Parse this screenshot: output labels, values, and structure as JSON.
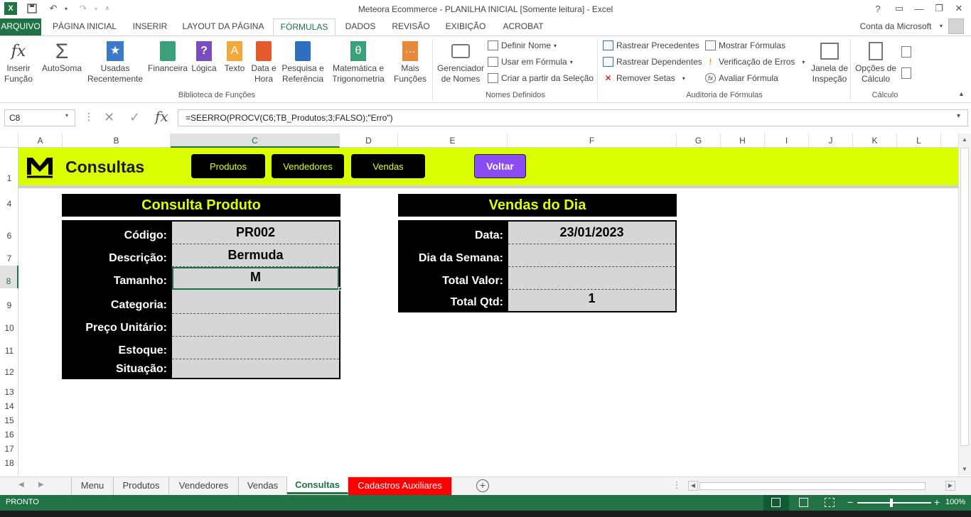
{
  "window": {
    "title": "Meteora Ecommerce - PLANILHA INICIAL  [Somente leitura] - Excel",
    "help": "?",
    "account": "Conta da Microsoft"
  },
  "tabs": [
    "ARQUIVO",
    "PÁGINA INICIAL",
    "INSERIR",
    "LAYOUT DA PÁGINA",
    "FÓRMULAS",
    "DADOS",
    "REVISÃO",
    "EXIBIÇÃO",
    "ACROBAT"
  ],
  "ribbon": {
    "insert_function": "Inserir Função",
    "autosum": "AutoSoma",
    "recent": "Usadas Recentemente",
    "financial": "Financeira",
    "logical": "Lógica",
    "text": "Texto",
    "datetime": "Data e Hora",
    "lookup": "Pesquisa e Referência",
    "math": "Matemática e Trigonometria",
    "more": "Mais Funções",
    "group_library": "Biblioteca de Funções",
    "name_manager": "Gerenciador de Nomes",
    "define_name": "Definir Nome",
    "use_in_formula": "Usar em Fórmula",
    "create_from_selection": "Criar a partir da Seleção",
    "group_names": "Nomes Definidos",
    "trace_precedents": "Rastrear Precedentes",
    "trace_dependents": "Rastrear Dependentes",
    "remove_arrows": "Remover Setas",
    "show_formulas": "Mostrar Fórmulas",
    "error_checking": "Verificação de Erros",
    "evaluate_formula": "Avaliar Fórmula",
    "watch_window": "Janela de Inspeção",
    "group_auditing": "Auditoria de Fórmulas",
    "calc_options": "Opções de Cálculo",
    "group_calc": "Cálculo"
  },
  "formula_bar": {
    "name_box": "C8",
    "formula": "=SEERRO(PROCV(C6;TB_Produtos;3;FALSO);\"Erro\")"
  },
  "columns": [
    "A",
    "B",
    "C",
    "D",
    "E",
    "F",
    "G",
    "H",
    "I",
    "J",
    "K",
    "L"
  ],
  "rows": [
    "1",
    "4",
    "6",
    "7",
    "8",
    "9",
    "10",
    "11",
    "12",
    "13",
    "14",
    "15",
    "16",
    "17",
    "18"
  ],
  "banner": {
    "logo": "M",
    "title": "Consultas",
    "buttons": [
      "Produtos",
      "Vendedores",
      "Vendas"
    ],
    "back": "Voltar"
  },
  "product_panel": {
    "header": "Consulta Produto",
    "rows": [
      {
        "label": "Código:",
        "value": "PR002"
      },
      {
        "label": "Descrição:",
        "value": "Bermuda"
      },
      {
        "label": "Tamanho:",
        "value": "M"
      },
      {
        "label": "Categoria:",
        "value": ""
      },
      {
        "label": "Preço Unitário:",
        "value": ""
      },
      {
        "label": "Estoque:",
        "value": ""
      },
      {
        "label": "Situação:",
        "value": ""
      }
    ]
  },
  "sales_panel": {
    "header": "Vendas do Dia",
    "rows": [
      {
        "label": "Data:",
        "value": "23/01/2023"
      },
      {
        "label": "Dia da Semana:",
        "value": ""
      },
      {
        "label": "Total Valor:",
        "value": ""
      },
      {
        "label": "Total Qtd:",
        "value": "1"
      }
    ]
  },
  "sheet_tabs": [
    "Menu",
    "Produtos",
    "Vendedores",
    "Vendas",
    "Consultas",
    "Cadastros Auxiliares"
  ],
  "status": {
    "ready": "PRONTO",
    "zoom": "100%"
  },
  "colors": {
    "excel_green": "#217346",
    "banner": "#dcff00",
    "back_button": "#8a4df2",
    "aux_tab": "#ff0000"
  }
}
